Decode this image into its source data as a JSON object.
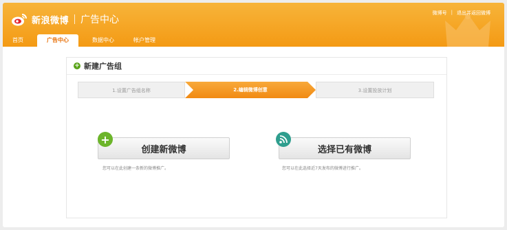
{
  "header": {
    "brand": "新浪微博",
    "subtitle": "广告中心",
    "top_links": [
      "微博号",
      "退出并返回微博"
    ],
    "top_sep": "|",
    "nav": [
      "首页",
      "广告中心",
      "数据中心",
      "帐户管理"
    ],
    "active_index": 1,
    "accent": "#f49a14"
  },
  "panel": {
    "title": "新建广告组",
    "steps": [
      "1.设置广告组名称",
      "2.编辑微博创意",
      "3.设置投放计划"
    ],
    "active_step": 2
  },
  "options": [
    {
      "label": "创建新微博",
      "hint": "您可以在此创建一条新的微博推广。",
      "icon": "plus-icon"
    },
    {
      "label": "选择已有微博",
      "hint": "您可以在此选择近7天发布的微博进行推广。",
      "icon": "signal-icon"
    }
  ]
}
